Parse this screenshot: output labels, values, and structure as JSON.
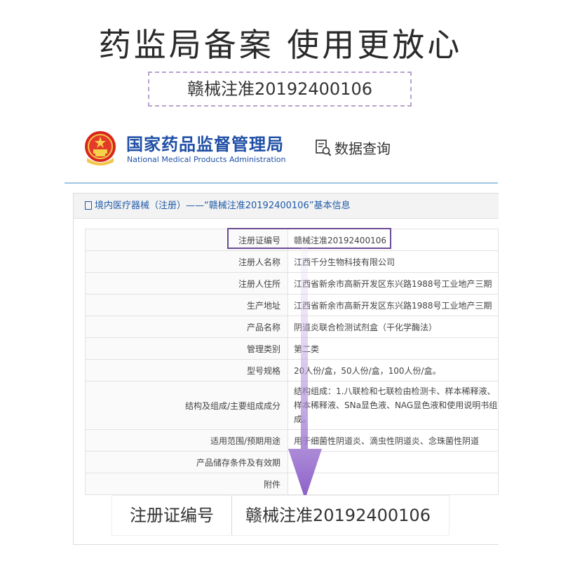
{
  "headline": "药监局备案 使用更放心",
  "registration_number": "赣械注准20192400106",
  "agency": {
    "name_cn": "国家药品监督管理局",
    "name_en": "National Medical Products Administration"
  },
  "query_label": "数据查询",
  "panel": {
    "title": "境内医疗器械（注册）——“赣械注准20192400106”基本信息",
    "rows": [
      {
        "key": "注册证编号",
        "value": "赣械注准20192400106"
      },
      {
        "key": "注册人名称",
        "value": "江西千分生物科技有限公司"
      },
      {
        "key": "注册人住所",
        "value": "江西省新余市高新开发区东兴路1988号工业地产三期"
      },
      {
        "key": "生产地址",
        "value": "江西省新余市高新开发区东兴路1988号工业地产三期"
      },
      {
        "key": "产品名称",
        "value": "阴道炎联合检测试剂盒（干化学酶法）"
      },
      {
        "key": "管理类别",
        "value": "第二类"
      },
      {
        "key": "型号规格",
        "value": "20人份/盒，50人份/盒，100人份/盒。"
      },
      {
        "key": "结构及组成/主要组成成分",
        "value": "结构组成：1.八联检和七联检由检测卡、样本稀释液、样本稀释液、SNa显色液、NAG显色液和使用说明书组成。"
      },
      {
        "key": "适用范围/预期用途",
        "value": "用于细菌性阴道炎、滴虫性阴道炎、念珠菌性阴道"
      },
      {
        "key": "产品储存条件及有效期",
        "value": ""
      },
      {
        "key": "附件",
        "value": ""
      }
    ]
  },
  "zoom": {
    "key": "注册证编号",
    "value": "赣械注准20192400106"
  },
  "colors": {
    "agency_blue": "#1f4fa6",
    "highlight_purple": "#6b4b95",
    "arrow_purple": "#8a5cc7",
    "dashed_border": "#b9a2cf"
  }
}
